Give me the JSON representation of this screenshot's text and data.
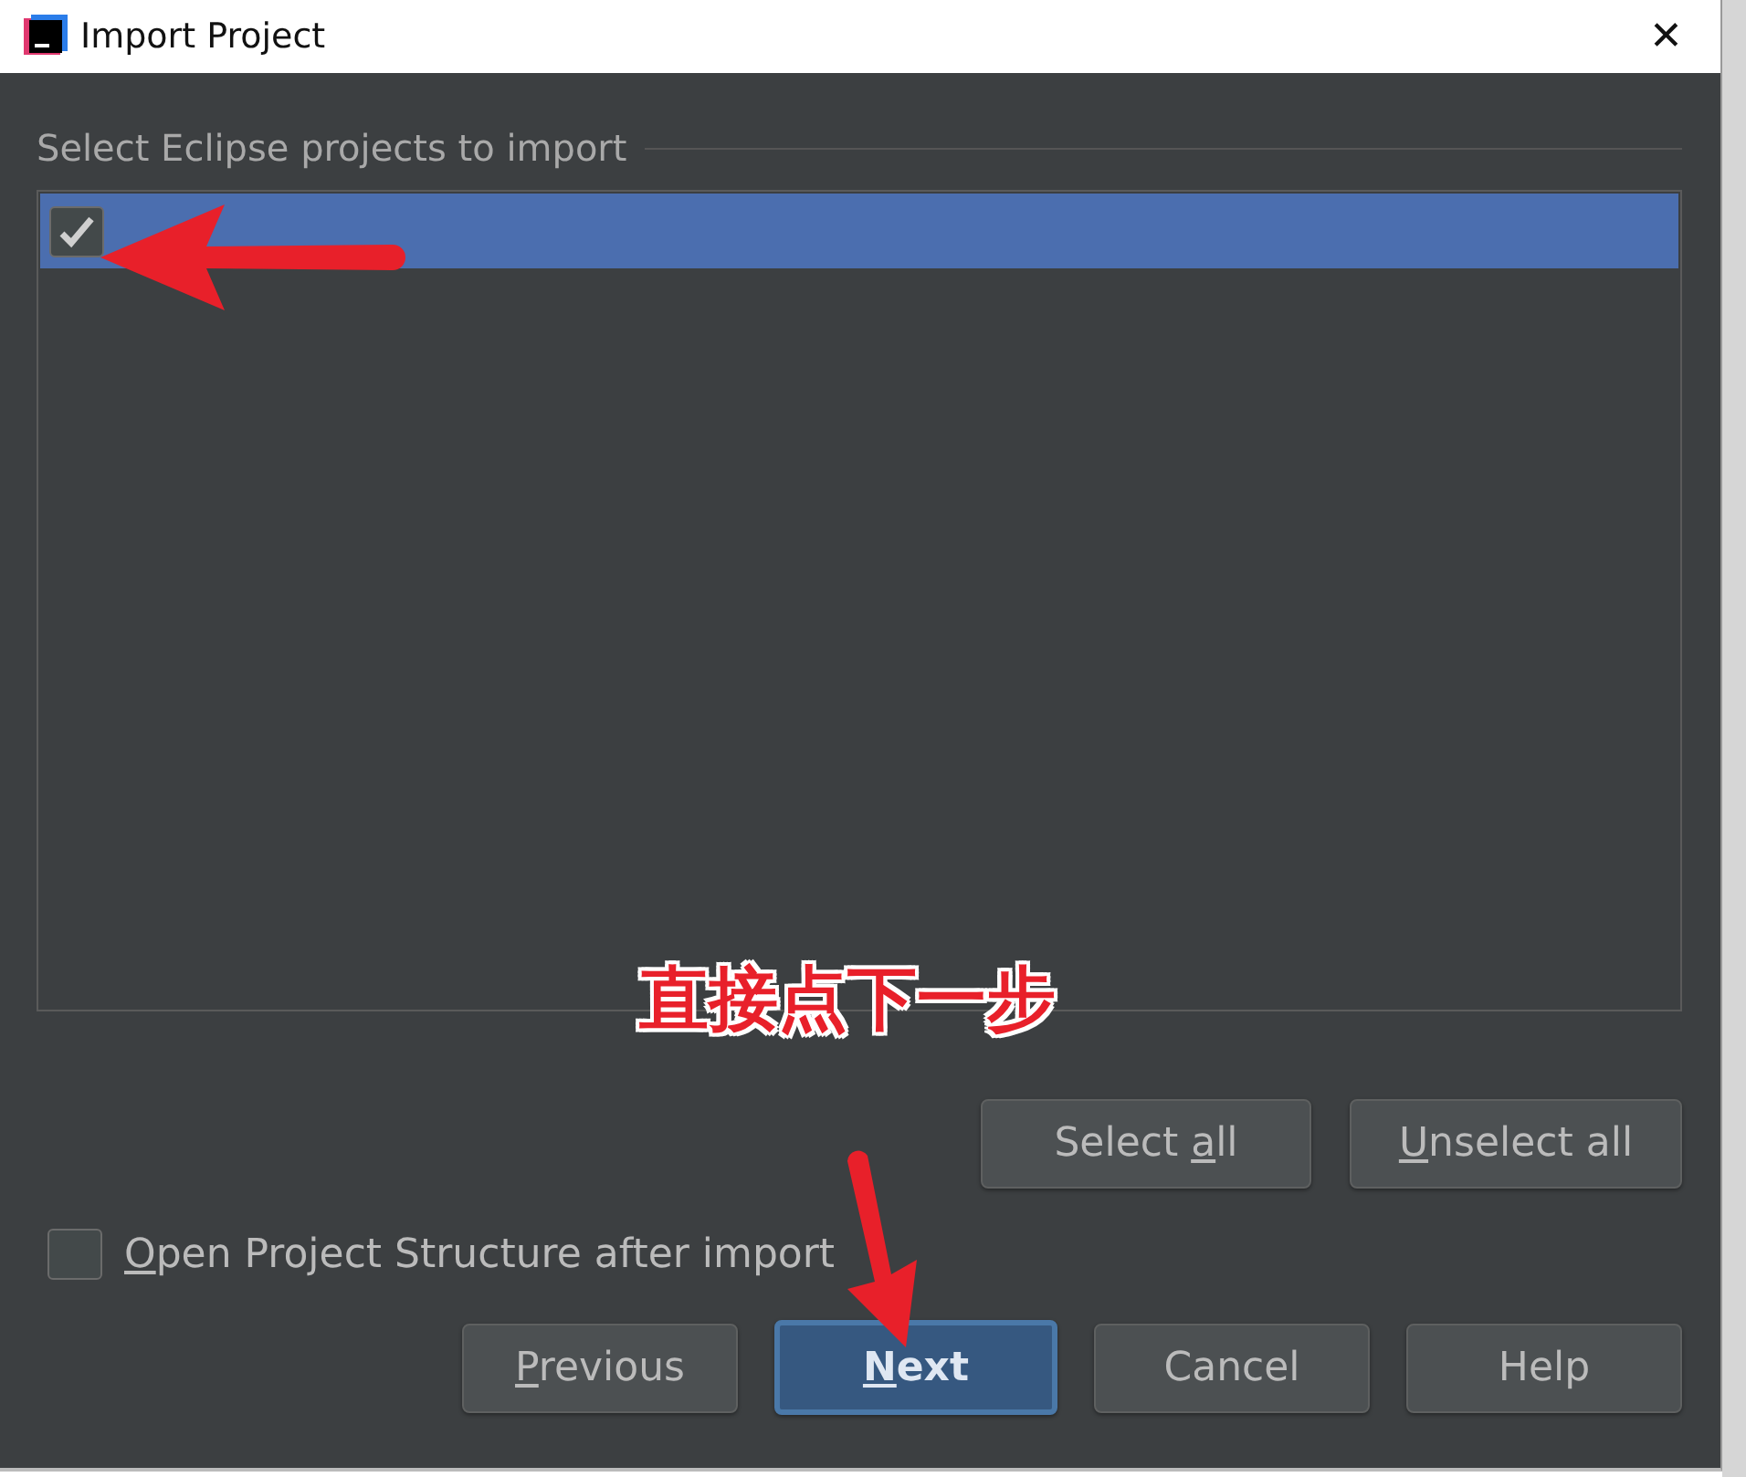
{
  "window": {
    "title": "Import Project",
    "close": "✕"
  },
  "section": {
    "title": "Select Eclipse projects to import"
  },
  "projects": [
    {
      "checked": true,
      "selected": true
    }
  ],
  "list_buttons": [
    {
      "label": {
        "before": "Select ",
        "mnemonic": "a",
        "after": "ll"
      }
    },
    {
      "label": {
        "mnemonic": "U",
        "after": "nselect all"
      }
    }
  ],
  "option": {
    "label": {
      "mnemonic": "O",
      "after": "pen Project Structure after import"
    },
    "checked": false
  },
  "buttons": [
    {
      "label": {
        "mnemonic": "P",
        "after": "revious"
      },
      "default": false
    },
    {
      "label": {
        "mnemonic": "N",
        "after": "ext"
      },
      "default": true
    },
    {
      "label": {
        "before": "Cancel"
      },
      "default": false
    },
    {
      "label": {
        "before": "Help"
      },
      "default": false
    }
  ],
  "annotation": {
    "text": "直接点下一步"
  }
}
